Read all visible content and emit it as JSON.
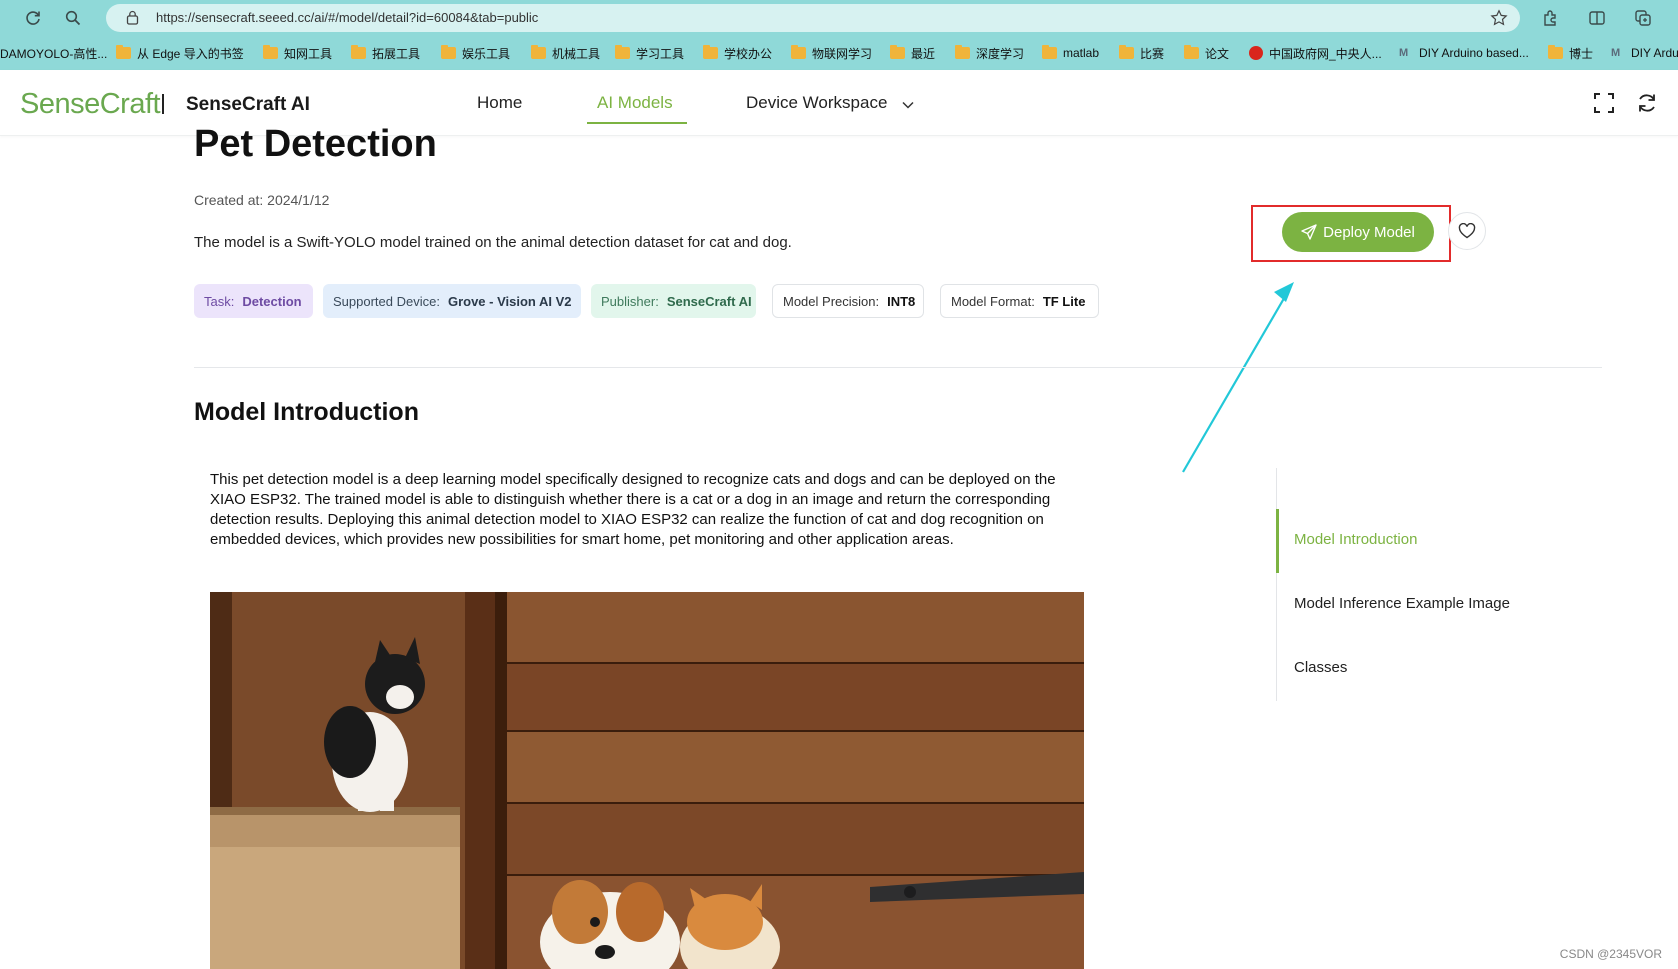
{
  "browser": {
    "url": "https://sensecraft.seeed.cc/ai/#/model/detail?id=60084&tab=public",
    "bookmarks": [
      {
        "label": "DAMOYOLO-高性...",
        "icon": "none"
      },
      {
        "label": "从 Edge 导入的书签",
        "icon": "folder"
      },
      {
        "label": "知网工具",
        "icon": "folder"
      },
      {
        "label": "拓展工具",
        "icon": "folder"
      },
      {
        "label": "娱乐工具",
        "icon": "folder"
      },
      {
        "label": "机械工具",
        "icon": "folder"
      },
      {
        "label": "学习工具",
        "icon": "folder"
      },
      {
        "label": "学校办公",
        "icon": "folder"
      },
      {
        "label": "物联网学习",
        "icon": "folder"
      },
      {
        "label": "最近",
        "icon": "folder"
      },
      {
        "label": "深度学习",
        "icon": "folder"
      },
      {
        "label": "matlab",
        "icon": "folder"
      },
      {
        "label": "比赛",
        "icon": "folder"
      },
      {
        "label": "论文",
        "icon": "folder"
      },
      {
        "label": "中国政府网_中央人...",
        "icon": "gov"
      },
      {
        "label": "DIY Arduino based...",
        "icon": "m-logo"
      },
      {
        "label": "博士",
        "icon": "folder"
      },
      {
        "label": "DIY Ardu",
        "icon": "m-logo"
      }
    ]
  },
  "header": {
    "logo": "SenseCraft",
    "brand": "SenseCraft AI",
    "nav": [
      {
        "label": "Home",
        "active": false
      },
      {
        "label": "AI Models",
        "active": true
      },
      {
        "label": "Device Workspace",
        "active": false
      }
    ]
  },
  "model": {
    "title": "Pet Detection",
    "created": "Created at: 2024/1/12",
    "description": "The model is a Swift-YOLO model trained on the animal detection dataset for cat and dog.",
    "tags": {
      "task": {
        "key": "Task:",
        "value": "Detection"
      },
      "device": {
        "key": "Supported Device:",
        "value": "Grove - Vision AI V2"
      },
      "publisher": {
        "key": "Publisher:",
        "value": "SenseCraft AI"
      },
      "precision": {
        "key": "Model Precision:",
        "value": "INT8"
      },
      "format": {
        "key": "Model Format:",
        "value": "TF Lite"
      }
    },
    "deploy_label": "Deploy Model"
  },
  "intro": {
    "title": "Model Introduction",
    "text": "This pet detection model is a deep learning model specifically designed to recognize cats and dogs and can be deployed on the XIAO ESP32. The trained model is able to distinguish whether there is a cat or a dog in an image and return the corresponding detection results. Deploying this animal detection model to XIAO ESP32 can realize the function of cat and dog recognition on embedded devices, which provides new possibilities for smart home, pet monitoring and other application areas."
  },
  "toc": [
    {
      "label": "Model Introduction",
      "active": true
    },
    {
      "label": "Model Inference Example Image",
      "active": false
    },
    {
      "label": "Classes",
      "active": false
    }
  ],
  "colors": {
    "accent": "#7cb342",
    "browser_chrome": "#8fd9d8",
    "highlight_box": "#e22b2b",
    "annotation_arrow": "#22c8d8"
  },
  "watermark": "CSDN @2345VOR"
}
